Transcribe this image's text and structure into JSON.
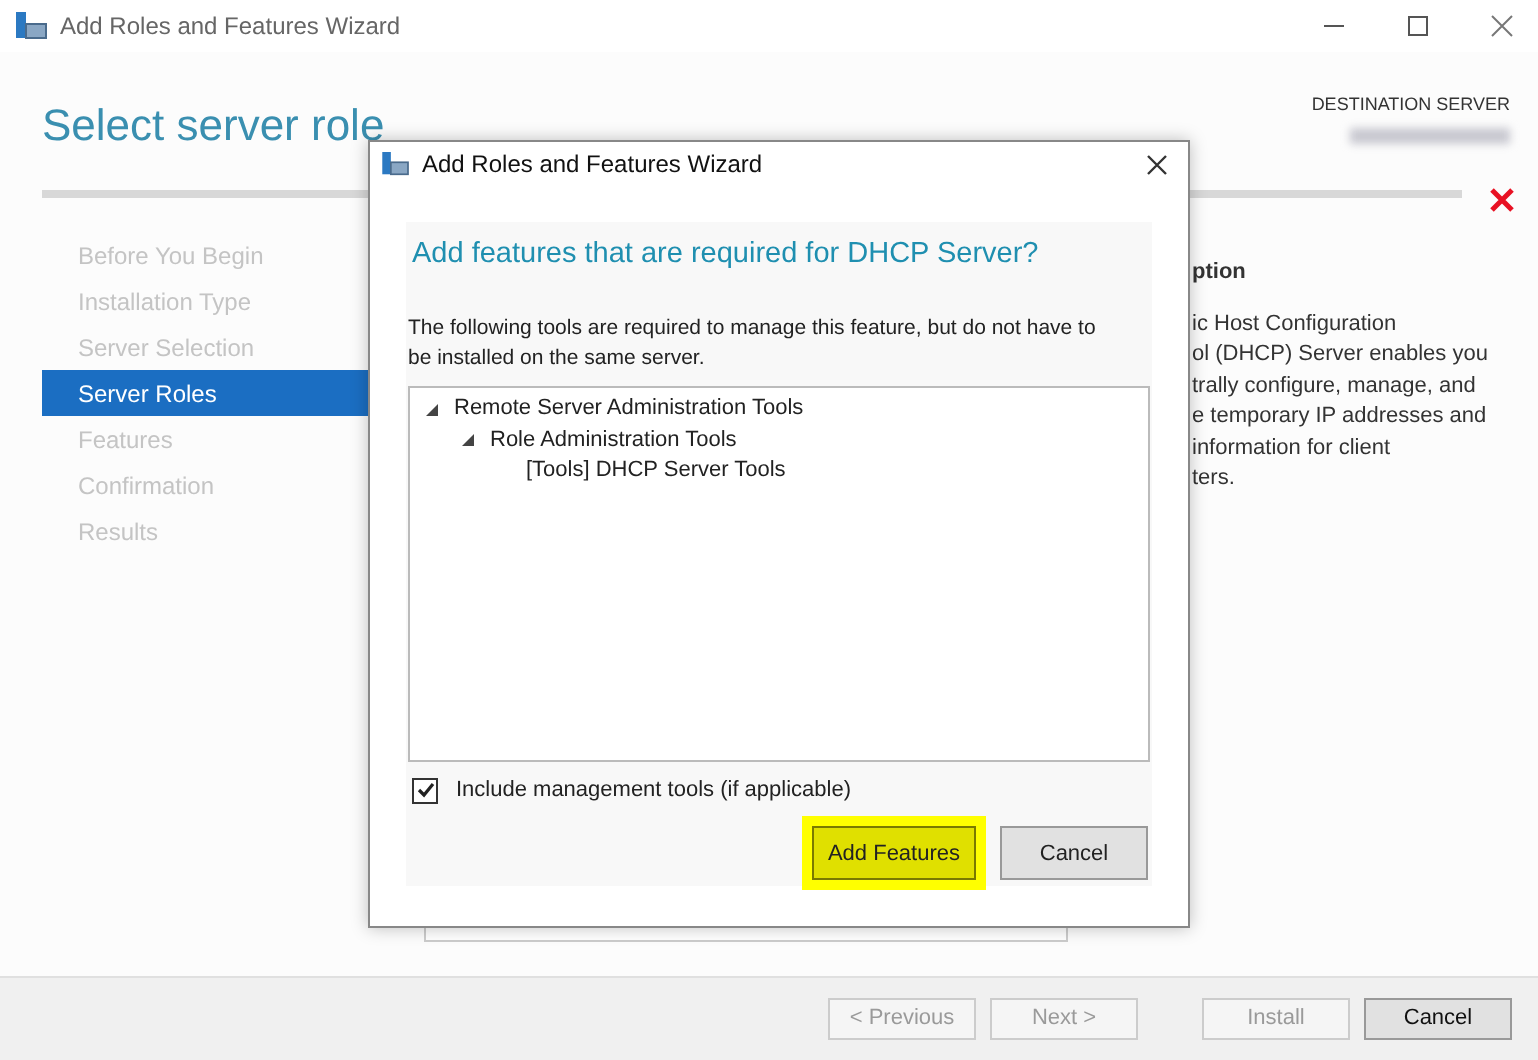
{
  "window": {
    "title": "Add Roles and Features Wizard"
  },
  "page_title": "Select server role",
  "destination": {
    "label": "DESTINATION SERVER"
  },
  "nav": [
    {
      "label": "Before You Begin",
      "selected": false
    },
    {
      "label": "Installation Type",
      "selected": false
    },
    {
      "label": "Server Selection",
      "selected": false
    },
    {
      "label": "Server Roles",
      "selected": true
    },
    {
      "label": "Features",
      "selected": false
    },
    {
      "label": "Confirmation",
      "selected": false
    },
    {
      "label": "Results",
      "selected": false
    }
  ],
  "description": {
    "heading": "ption",
    "lines": [
      "ic Host Configuration",
      "ol (DHCP) Server enables you",
      "trally configure, manage, and",
      "e temporary IP addresses and",
      "information for client",
      "ters."
    ]
  },
  "footer_buttons": [
    {
      "label": "< Previous",
      "disabled": true
    },
    {
      "label": "Next >",
      "disabled": true
    },
    {
      "label": "Install",
      "disabled": true
    },
    {
      "label": "Cancel",
      "disabled": false
    }
  ],
  "dialog": {
    "title": "Add Roles and Features Wizard",
    "heading": "Add features that are required for DHCP Server?",
    "text": "The following tools are required to manage this feature, but do not have to be installed on the same server.",
    "tree": [
      {
        "label": "Remote Server Administration Tools",
        "expanded": true,
        "children": [
          {
            "label": "Role Administration Tools",
            "expanded": true,
            "children": [
              {
                "label": "[Tools] DHCP Server Tools"
              }
            ]
          }
        ]
      }
    ],
    "checkbox": {
      "label": "Include management tools (if applicable)",
      "checked": true
    },
    "buttons": [
      {
        "label": "Add Features",
        "highlighted": true
      },
      {
        "label": "Cancel",
        "highlighted": false
      }
    ]
  }
}
